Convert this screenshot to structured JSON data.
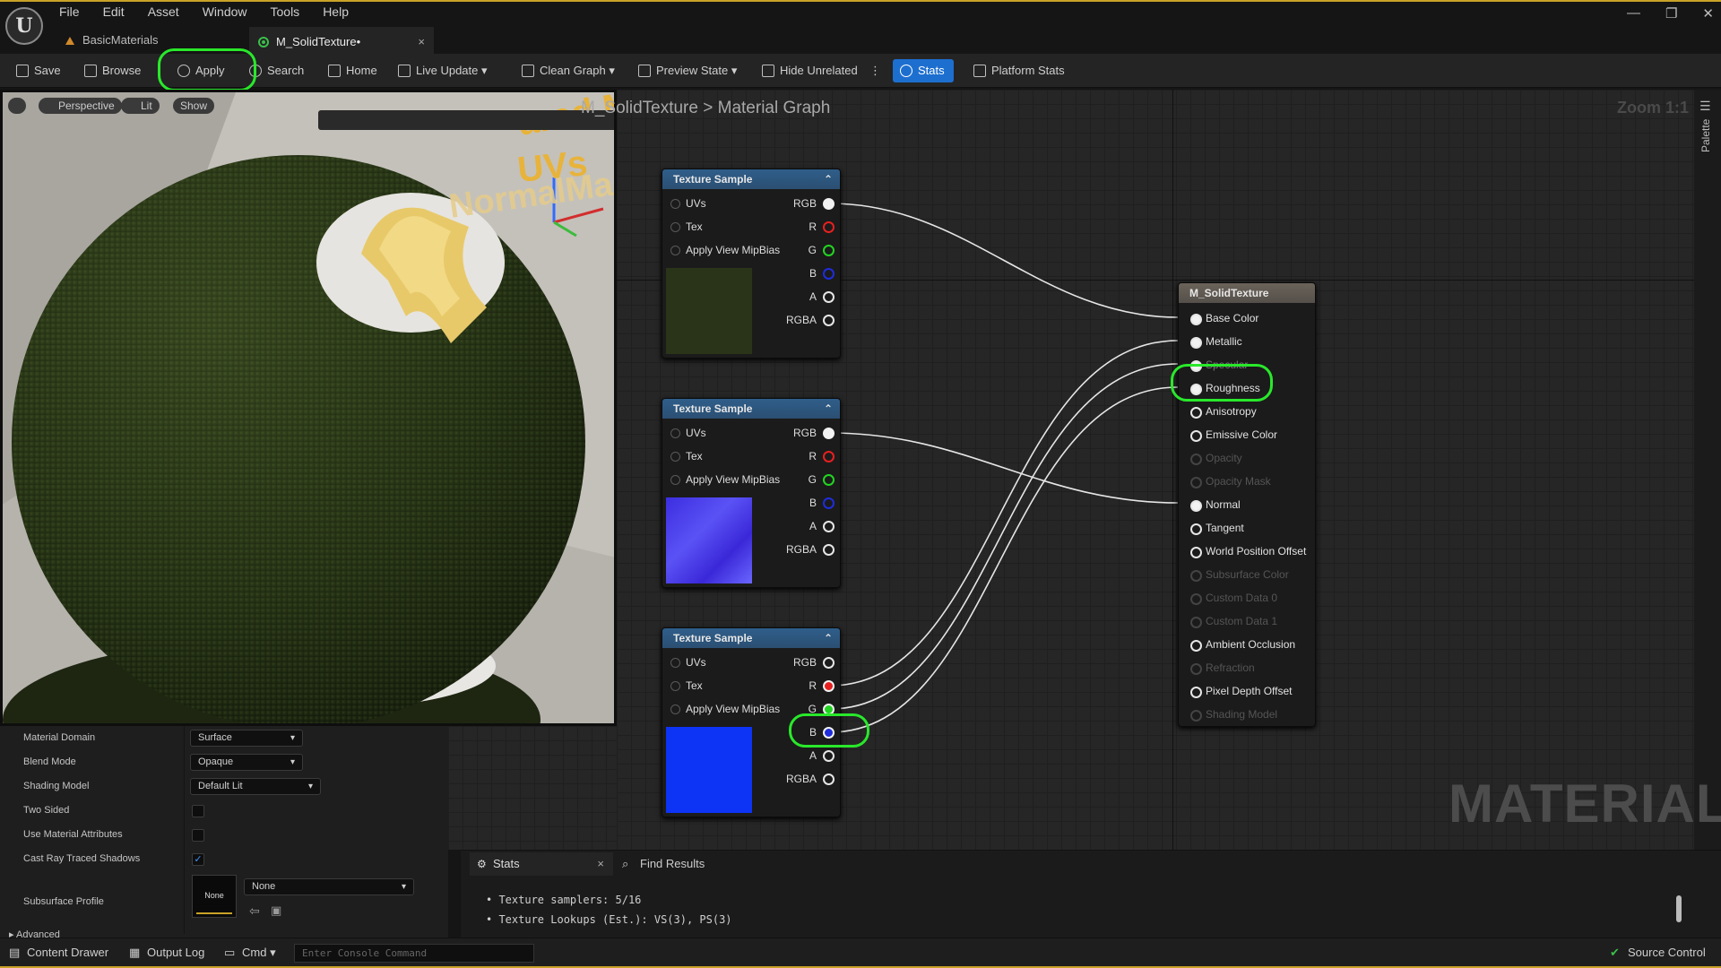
{
  "menu": [
    "File",
    "Edit",
    "Asset",
    "Window",
    "Tools",
    "Help"
  ],
  "tabs": [
    {
      "label": "BasicMaterials",
      "icon": "material-folder-icon"
    },
    {
      "label": "M_SolidTexture•",
      "icon": "material-icon"
    }
  ],
  "toolbar": {
    "save": "Save",
    "browse": "Browse",
    "apply": "Apply",
    "search": "Search",
    "home": "Home",
    "live_update": "Live Update",
    "clean_graph": "Clean Graph",
    "preview_state": "Preview State",
    "hide_unrelated": "Hide Unrelated",
    "stats": "Stats",
    "platform_stats": "Platform Stats"
  },
  "viewport": {
    "perspective": "Perspective",
    "lit": "Lit",
    "show": "Show",
    "overlay_text": [
      "ared Mate",
      "UVs",
      "NormalMa"
    ]
  },
  "details": {
    "rows": [
      {
        "label": "Material Domain",
        "value": "Surface"
      },
      {
        "label": "Blend Mode",
        "value": "Opaque"
      },
      {
        "label": "Shading Model",
        "value": "Default Lit"
      },
      {
        "label": "Two Sided",
        "checked": false
      },
      {
        "label": "Use Material Attributes",
        "checked": false
      },
      {
        "label": "Cast Ray Traced Shadows",
        "checked": true
      },
      {
        "label": "Subsurface Profile",
        "value": "None",
        "thumb": "None"
      }
    ],
    "advanced": "Advanced"
  },
  "graph": {
    "breadcrumb_asset": "M_SolidTexture",
    "breadcrumb_sep": ">",
    "breadcrumb_graph": "Material Graph",
    "zoom": "Zoom 1:1",
    "watermark": "MATERIAL",
    "palette": "Palette"
  },
  "texture_node": {
    "title": "Texture Sample",
    "inputs": [
      "UVs",
      "Tex",
      "Apply View MipBias"
    ],
    "outputs": [
      "RGB",
      "R",
      "G",
      "B",
      "A",
      "RGBA"
    ]
  },
  "texture_nodes": [
    {
      "thumb_color": "#2a3418"
    },
    {
      "thumb_color": "#4a3cf0"
    },
    {
      "thumb_color": "#0d33f5"
    }
  ],
  "material_node": {
    "title": "M_SolidTexture",
    "pins": [
      {
        "label": "Base Color",
        "enabled": true,
        "connected": true
      },
      {
        "label": "Metallic",
        "enabled": true,
        "connected": true
      },
      {
        "label": "Specular",
        "enabled": true,
        "connected": true
      },
      {
        "label": "Roughness",
        "enabled": true,
        "connected": true
      },
      {
        "label": "Anisotropy",
        "enabled": true,
        "connected": false
      },
      {
        "label": "Emissive Color",
        "enabled": true,
        "connected": false
      },
      {
        "label": "Opacity",
        "enabled": false,
        "connected": false
      },
      {
        "label": "Opacity Mask",
        "enabled": false,
        "connected": false
      },
      {
        "label": "Normal",
        "enabled": true,
        "connected": true
      },
      {
        "label": "Tangent",
        "enabled": true,
        "connected": false
      },
      {
        "label": "World Position Offset",
        "enabled": true,
        "connected": false
      },
      {
        "label": "Subsurface Color",
        "enabled": false,
        "connected": false
      },
      {
        "label": "Custom Data 0",
        "enabled": false,
        "connected": false
      },
      {
        "label": "Custom Data 1",
        "enabled": false,
        "connected": false
      },
      {
        "label": "Ambient Occlusion",
        "enabled": true,
        "connected": false
      },
      {
        "label": "Refraction",
        "enabled": false,
        "connected": false
      },
      {
        "label": "Pixel Depth Offset",
        "enabled": true,
        "connected": false
      },
      {
        "label": "Shading Model",
        "enabled": false,
        "connected": false
      }
    ]
  },
  "stats_panel": {
    "tab_stats": "Stats",
    "tab_find": "Find Results",
    "lines": [
      "• Texture samplers: 5/16",
      "• Texture Lookups (Est.): VS(3), PS(3)"
    ]
  },
  "statusbar": {
    "content_drawer": "Content Drawer",
    "output_log": "Output Log",
    "cmd": "Cmd",
    "console_placeholder": "Enter Console Command",
    "source_control": "Source Control"
  },
  "colors": {
    "accent": "#1d6fcf",
    "highlight": "#29e82b",
    "frame": "#c9a227"
  }
}
